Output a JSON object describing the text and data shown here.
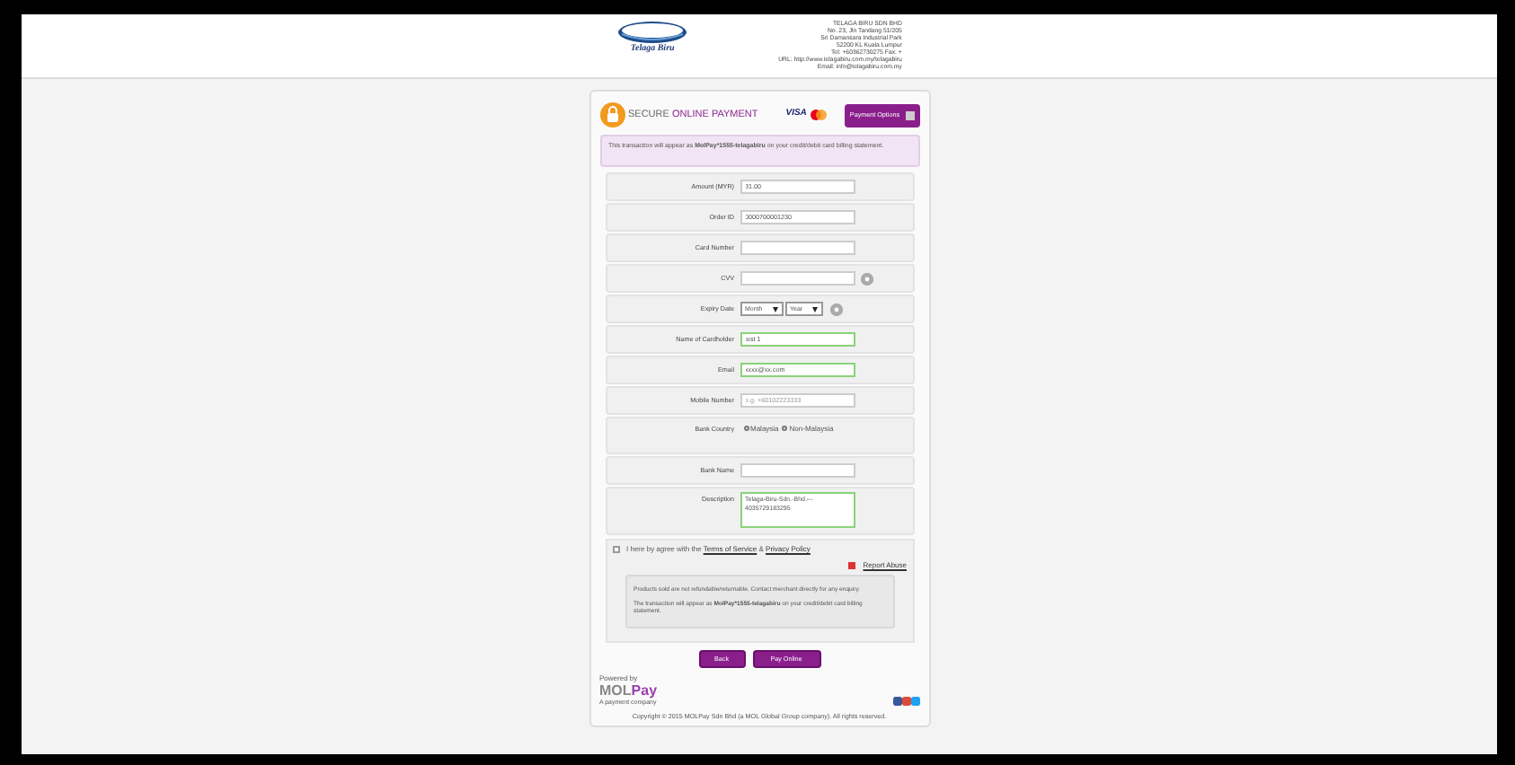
{
  "header": {
    "logo_text": "Telaga Biru",
    "company_lines": [
      "TELAGA BIRU SDN BHD",
      "No. 23, Jln Tandang 51/205",
      "Sri Damansara Industrial Park",
      "52200 KL Kuala Lumpur",
      "Tel: +60362730275   Fax: +"
    ],
    "url_label": "URL:",
    "url": "http://www.telagabiru.com.my/telagabiru",
    "email_label": "Email:",
    "email": "info@telagabiru.com.my"
  },
  "payment": {
    "title_secure": "SECURE",
    "title_rest": "ONLINE PAYMENT",
    "visa": "VISA",
    "options_button": "Payment Options",
    "notice": "This transaction will appear as **MolPay*1555-telagabiru** on your credit/debit card billing statement.",
    "fields": [
      {
        "kind": "text",
        "label": "Amount (MYR)",
        "value": "31.00",
        "valid": false,
        "help": false
      },
      {
        "kind": "text",
        "label": "Order ID",
        "value": "0000700001230",
        "valid": false,
        "help": false
      },
      {
        "kind": "text",
        "label": "Card Number",
        "valid": false,
        "help": false
      },
      {
        "kind": "text",
        "label": "CVV",
        "valid": false,
        "help": true
      },
      {
        "kind": "expiry",
        "label": "Expiry Date",
        "month": "Month",
        "year": "Year",
        "help": true
      },
      {
        "kind": "text",
        "label": "Name of Cardholder",
        "value": "test 1",
        "valid": true,
        "help": false
      },
      {
        "kind": "text",
        "label": "Email",
        "value": "xxxx@xx.com",
        "valid": true,
        "help": false
      },
      {
        "kind": "text",
        "label": "Mobile Number",
        "placeholder": "e.g. +60102223333",
        "valid": false,
        "help": false
      },
      {
        "kind": "radio",
        "label": "Bank Country",
        "options": [
          {
            "label": "Malaysia",
            "selected": false
          },
          {
            "label": "Non-Malaysia",
            "selected": false
          }
        ]
      },
      {
        "kind": "text",
        "label": "Bank Name",
        "valid": false,
        "help": false
      },
      {
        "kind": "textarea",
        "label": "Description",
        "value": "Telaga-Biru-Sdn.-Bhd.---\n4035729183295",
        "valid": true
      }
    ],
    "agree": {
      "checked": false,
      "text_before": "I here by agree with the",
      "terms": "Terms of Service",
      "amp": "&",
      "privacy": "Privacy Policy"
    },
    "report": "Report Abuse",
    "notes": [
      "Products sold are not refundable/returnable. Contact merchant directly for any enquiry.",
      "The transaction will appear as **MolPay*1555-telagabiru** on your credit/debit card billing statement."
    ],
    "buttons": [
      "Back",
      "Pay Online"
    ],
    "powered_by": "Powered by",
    "brand_mol": "MOL",
    "brand_pay": "Pay",
    "brand_tagline": "A payment company",
    "copyright": "Copyright © 2015 MOLPay Sdn Bhd (a MOL Global Group company). All rights reserved."
  }
}
